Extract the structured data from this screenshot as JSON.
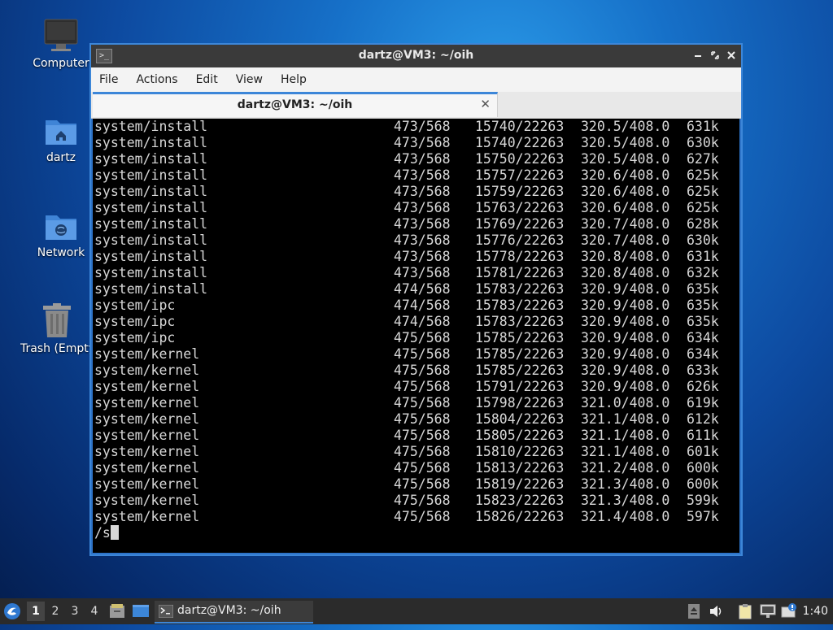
{
  "desktop": {
    "icons": [
      {
        "label": "Computer",
        "icon": "computer-icon"
      },
      {
        "label": "dartz",
        "icon": "home-folder-icon"
      },
      {
        "label": "Network",
        "icon": "network-folder-icon"
      },
      {
        "label": "Trash (Empty)",
        "icon": "trash-icon"
      }
    ]
  },
  "window": {
    "title": "dartz@VM3: ~/oih",
    "app_icon_glyph": ">_",
    "menu": [
      "File",
      "Actions",
      "Edit",
      "View",
      "Help"
    ],
    "tab": {
      "label": "dartz@VM3: ~/oih"
    },
    "terminal": {
      "rows": [
        [
          "system/install",
          "473/568",
          "15740/22263",
          "320.5/408.0",
          "631k"
        ],
        [
          "system/install",
          "473/568",
          "15740/22263",
          "320.5/408.0",
          "630k"
        ],
        [
          "system/install",
          "473/568",
          "15750/22263",
          "320.5/408.0",
          "627k"
        ],
        [
          "system/install",
          "473/568",
          "15757/22263",
          "320.6/408.0",
          "625k"
        ],
        [
          "system/install",
          "473/568",
          "15759/22263",
          "320.6/408.0",
          "625k"
        ],
        [
          "system/install",
          "473/568",
          "15763/22263",
          "320.6/408.0",
          "625k"
        ],
        [
          "system/install",
          "473/568",
          "15769/22263",
          "320.7/408.0",
          "628k"
        ],
        [
          "system/install",
          "473/568",
          "15776/22263",
          "320.7/408.0",
          "630k"
        ],
        [
          "system/install",
          "473/568",
          "15778/22263",
          "320.8/408.0",
          "631k"
        ],
        [
          "system/install",
          "473/568",
          "15781/22263",
          "320.8/408.0",
          "632k"
        ],
        [
          "system/install",
          "474/568",
          "15783/22263",
          "320.9/408.0",
          "635k"
        ],
        [
          "system/ipc",
          "474/568",
          "15783/22263",
          "320.9/408.0",
          "635k"
        ],
        [
          "system/ipc",
          "474/568",
          "15783/22263",
          "320.9/408.0",
          "635k"
        ],
        [
          "system/ipc",
          "475/568",
          "15785/22263",
          "320.9/408.0",
          "634k"
        ],
        [
          "system/kernel",
          "475/568",
          "15785/22263",
          "320.9/408.0",
          "634k"
        ],
        [
          "system/kernel",
          "475/568",
          "15785/22263",
          "320.9/408.0",
          "633k"
        ],
        [
          "system/kernel",
          "475/568",
          "15791/22263",
          "320.9/408.0",
          "626k"
        ],
        [
          "system/kernel",
          "475/568",
          "15798/22263",
          "321.0/408.0",
          "619k"
        ],
        [
          "system/kernel",
          "475/568",
          "15804/22263",
          "321.1/408.0",
          "612k"
        ],
        [
          "system/kernel",
          "475/568",
          "15805/22263",
          "321.1/408.0",
          "611k"
        ],
        [
          "system/kernel",
          "475/568",
          "15810/22263",
          "321.1/408.0",
          "601k"
        ],
        [
          "system/kernel",
          "475/568",
          "15813/22263",
          "321.2/408.0",
          "600k"
        ],
        [
          "system/kernel",
          "475/568",
          "15819/22263",
          "321.3/408.0",
          "600k"
        ],
        [
          "system/kernel",
          "475/568",
          "15823/22263",
          "321.3/408.0",
          "599k"
        ],
        [
          "system/kernel",
          "475/568",
          "15826/22263",
          "321.4/408.0",
          "597k"
        ]
      ],
      "prompt_text": "/s"
    }
  },
  "taskbar": {
    "workspaces": [
      "1",
      "2",
      "3",
      "4"
    ],
    "active_workspace": "1",
    "task_label": "dartz@VM3: ~/oih",
    "clock": "1:40"
  },
  "colors": {
    "accent": "#3c86d8",
    "terminal_bg": "#000000",
    "terminal_fg": "#d8d8d8",
    "titlebar": "#3a3a3a",
    "taskbar": "#2b2b2b"
  }
}
